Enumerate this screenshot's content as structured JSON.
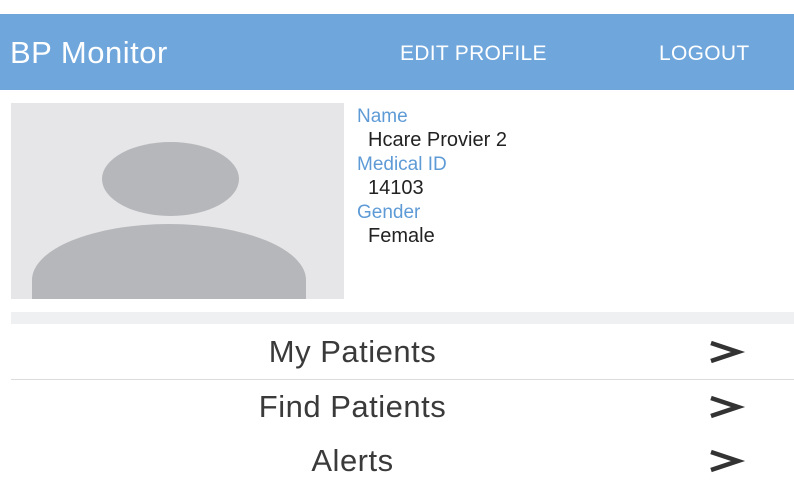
{
  "appbar": {
    "title": "BP Monitor",
    "edit_profile_label": "EDIT PROFILE",
    "logout_label": "LOGOUT",
    "background": "#6fa6dc",
    "text_color": "#ffffff"
  },
  "profile": {
    "avatar_icon": "person-placeholder-icon",
    "fields": [
      {
        "label": "Name",
        "value": "Hcare Provier 2"
      },
      {
        "label": "Medical ID",
        "value": "14103"
      },
      {
        "label": "Gender",
        "value": "Female"
      }
    ],
    "label_color": "#5e9bd6"
  },
  "menu": {
    "chevron_icon": "chevron-right-icon",
    "items": [
      {
        "label": "My Patients"
      },
      {
        "label": "Find Patients"
      },
      {
        "label": "Alerts"
      }
    ]
  }
}
